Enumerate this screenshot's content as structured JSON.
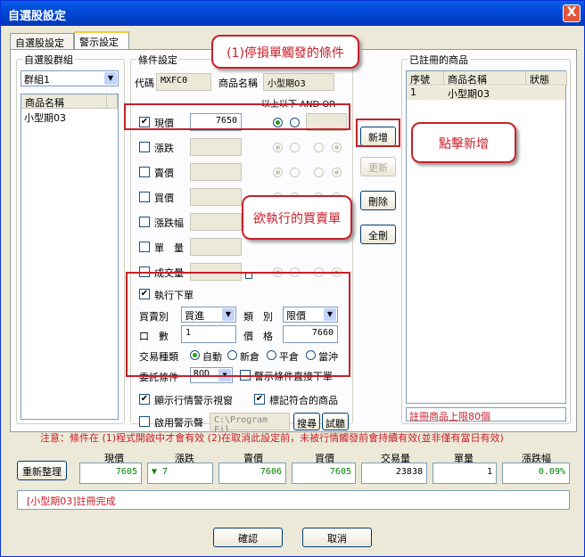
{
  "window": {
    "title": "自選股設定",
    "close": "X"
  },
  "tabs": [
    "自選股設定",
    "警示設定"
  ],
  "left": {
    "group_title": "自選股群組",
    "group_value": "群組1",
    "col": "商品名稱",
    "items": [
      "小型期03"
    ]
  },
  "cond": {
    "title": "條件設定",
    "code_label": "代碼",
    "code_value": "MXFC0",
    "name_label": "商品名稱",
    "name_value": "小型期03",
    "hdr": "以上以下 AND OR",
    "rows": [
      {
        "label": "現價",
        "checked": "✔",
        "value": "7650"
      },
      {
        "label": "漲跌"
      },
      {
        "label": "賣價"
      },
      {
        "label": "買價"
      },
      {
        "label": "漲跌幅"
      },
      {
        "label": "單　量"
      },
      {
        "label": "成交量"
      }
    ]
  },
  "order": {
    "title": "執行下單",
    "checked": "✔",
    "side_label": "買賣別",
    "side": "買進",
    "type_label": "類　別",
    "type": "限價",
    "qty_label": "口　數",
    "qty": "1",
    "price_label": "價　格",
    "price": "7660",
    "trade_label": "交易種類",
    "trade_opts": [
      "自動",
      "新倉",
      "平倉",
      "當沖"
    ],
    "entrust_label": "委託條件",
    "entrust": "ROD",
    "direct": "警示條件直接下單"
  },
  "show_window": "顯示行情警示視窗",
  "mark": "標記符合的商品",
  "sound": "啟用警示聲",
  "sound_path": "C:\\Program Fil",
  "browse": "搜尋",
  "test": "試聽",
  "buttons": {
    "add": "新增",
    "update": "更新",
    "del": "刪除",
    "clear": "全刪"
  },
  "reg": {
    "title": "已註冊的商品",
    "cols": [
      "序號",
      "商品名稱",
      "狀態"
    ],
    "rows": [
      [
        "1",
        "小型期03",
        ""
      ]
    ],
    "limit": "註冊商品上限80個"
  },
  "notice": "注意：條件在 (1)程式開啟中才會有效 (2)在取消此設定前，未被行情觸發前會持續有效(並非僅有當日有效)",
  "stats": {
    "refresh": "重新整理",
    "labels": [
      "現價",
      "漲跌",
      "賣價",
      "買價",
      "交易量",
      "單量",
      "漲跌幅"
    ],
    "values": [
      "7605",
      "▼  7",
      "7606",
      "7605",
      "23838",
      "1",
      "0.09%"
    ]
  },
  "status": "[小型期03]註冊完成",
  "footer": {
    "ok": "確認",
    "cancel": "取消"
  },
  "callouts": [
    "(1)停損單觸發的條件",
    "點擊新增",
    "欲執行的買賣單"
  ],
  "colors": {
    "annotation": "#c8202a",
    "title": "#0048d8"
  }
}
